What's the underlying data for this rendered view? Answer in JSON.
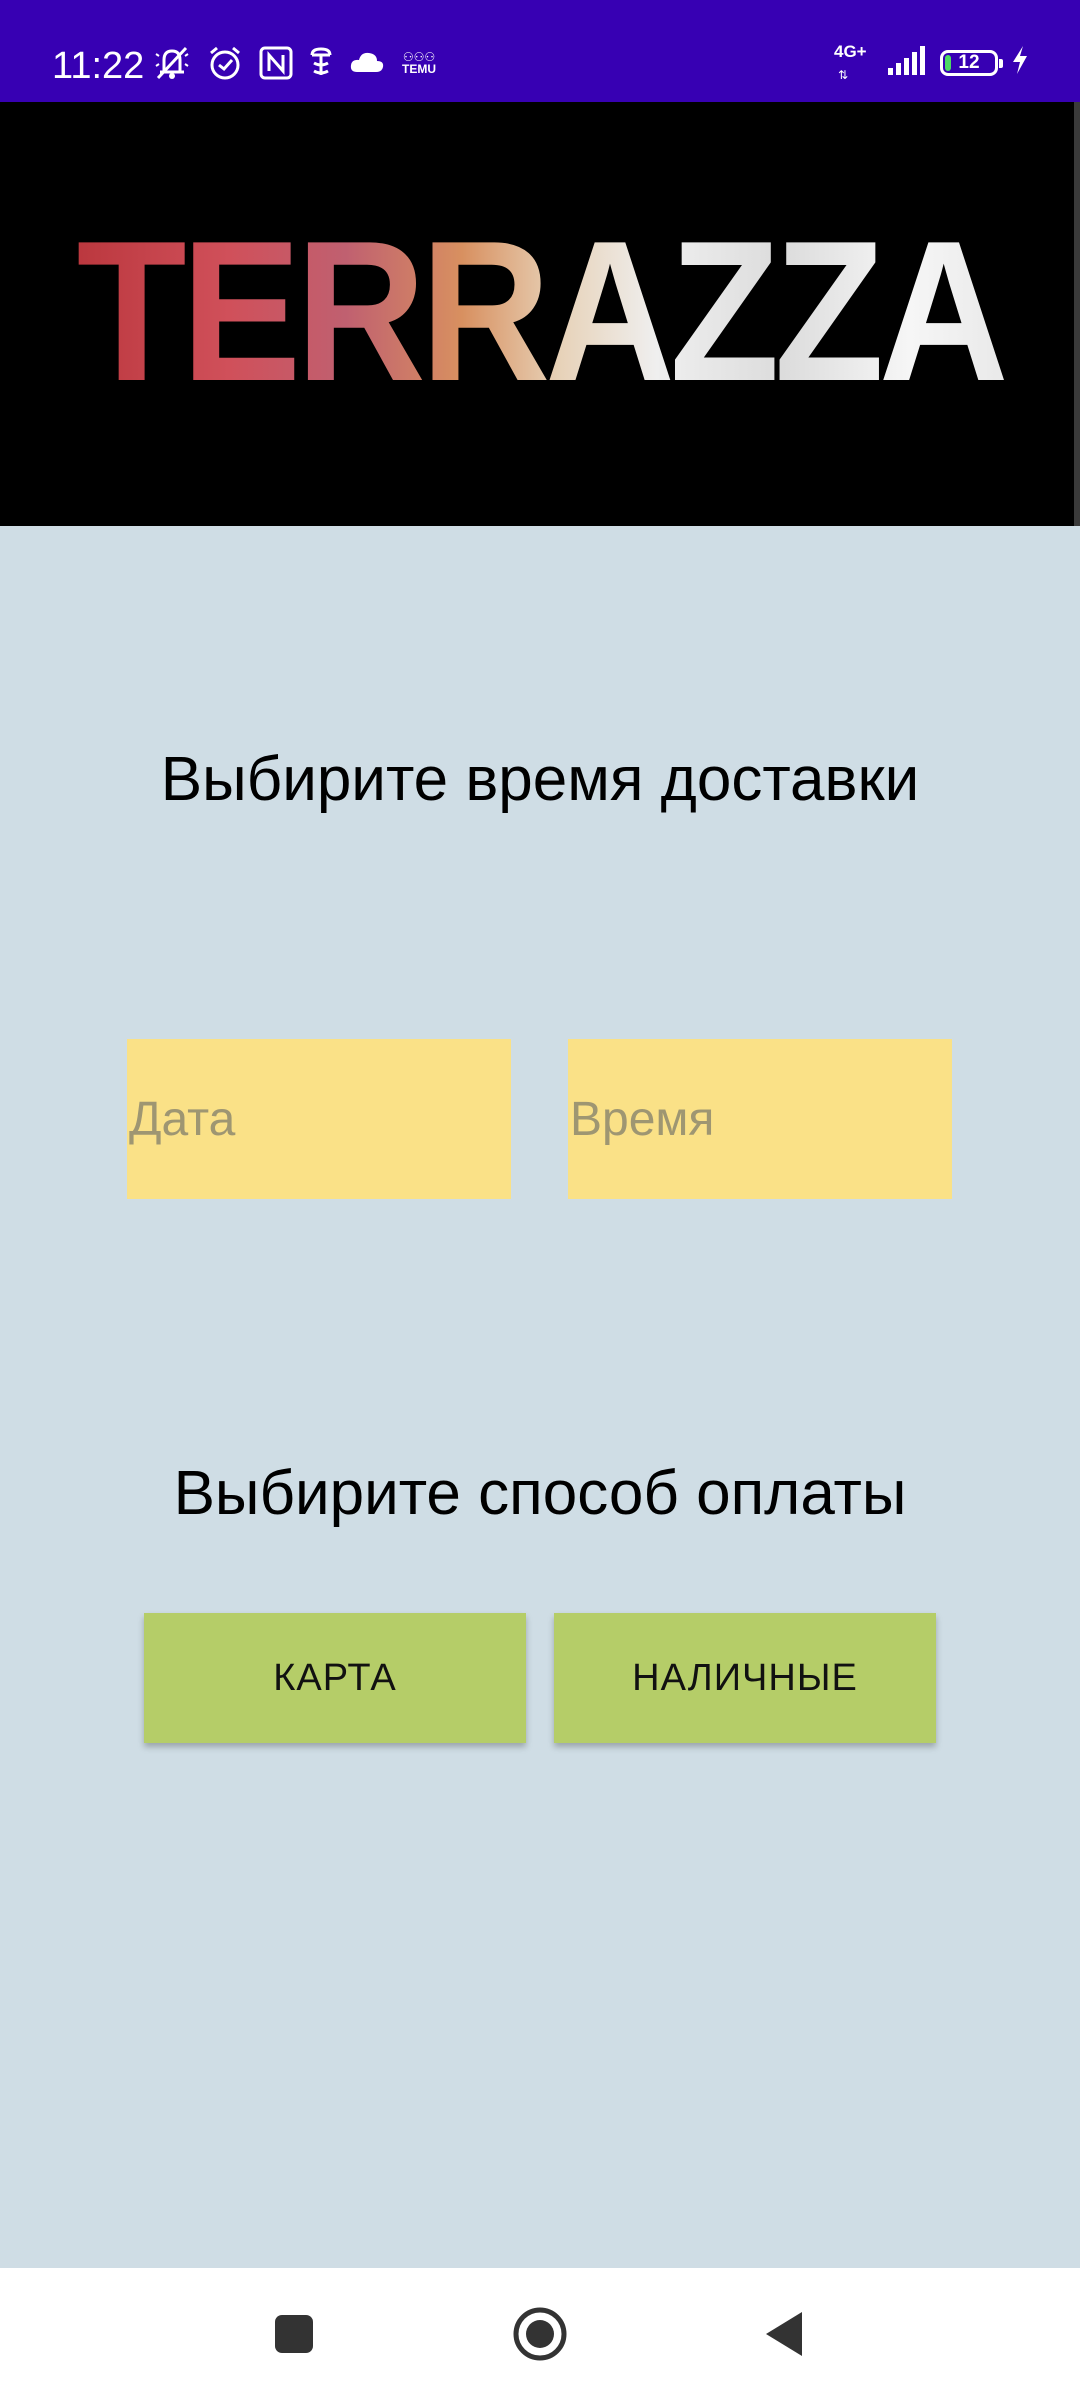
{
  "status_bar": {
    "time": "11:22",
    "left_icons": [
      "muted-notifications-icon",
      "alarm-icon",
      "nfc-icon",
      "app-notification-icon",
      "cloud-icon",
      "temu-icon"
    ],
    "temu_label": "TEMU",
    "network_type": "4G+",
    "battery_level": "12",
    "battery_fill": 0.12,
    "charging": true
  },
  "banner": {
    "logo_text": "TERRAZZA"
  },
  "delivery": {
    "heading": "Выбирите время доставки",
    "date_placeholder": "Дата",
    "time_placeholder": "Время"
  },
  "payment": {
    "heading": "Выбирите способ оплаты",
    "card_label": "КАРТА",
    "cash_label": "НАЛИЧНЫЕ"
  },
  "navigation": {
    "buttons": [
      "recents-icon",
      "home-icon",
      "back-icon"
    ]
  },
  "colors": {
    "status_bar": "#3700b3",
    "background": "#cfdde5",
    "field": "#fae187",
    "button": "#b5cd68",
    "banner": "#000000"
  }
}
